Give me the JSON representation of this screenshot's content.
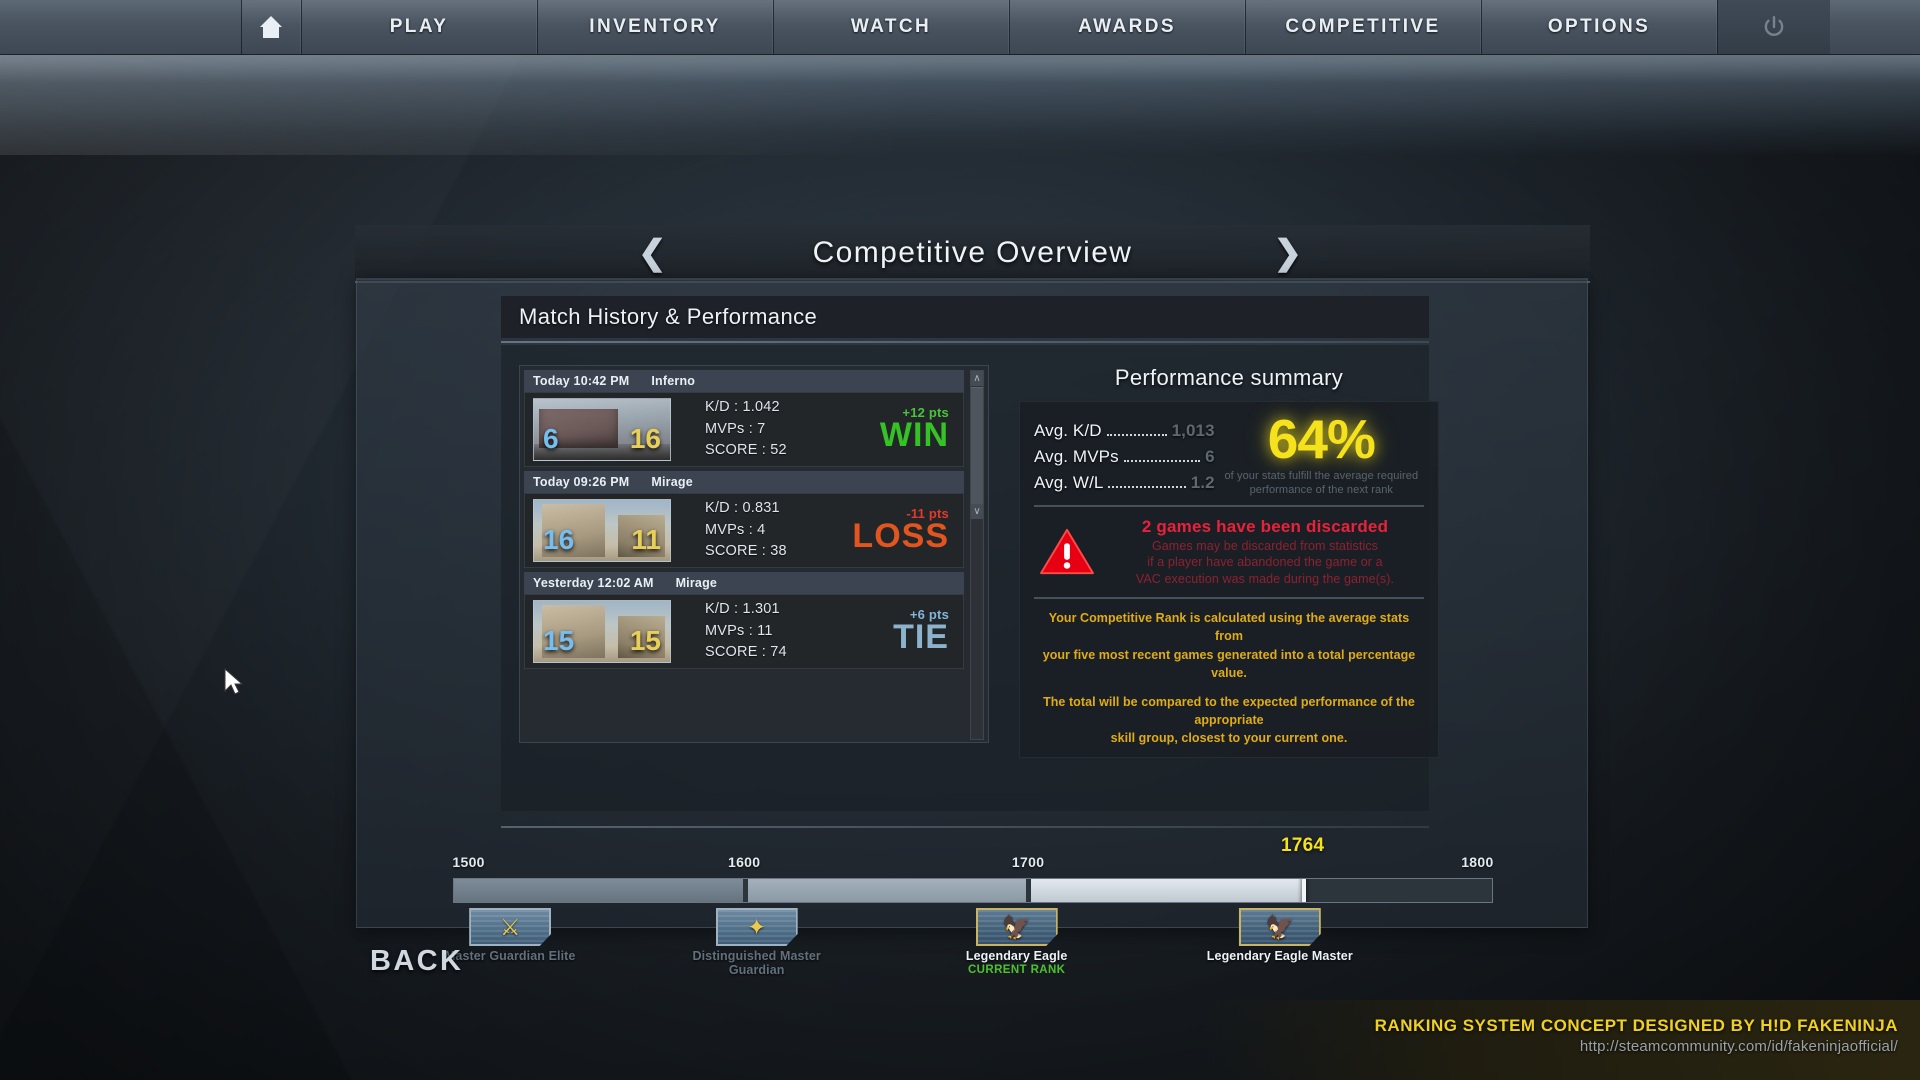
{
  "topnav": {
    "home_icon": "home-icon",
    "power_icon": "power-icon",
    "items": [
      {
        "label": "PLAY"
      },
      {
        "label": "INVENTORY"
      },
      {
        "label": "WATCH"
      },
      {
        "label": "AWARDS"
      },
      {
        "label": "COMPETITIVE"
      },
      {
        "label": "OPTIONS"
      }
    ]
  },
  "header": {
    "title": "Competitive Overview",
    "prev_arrow": "❮",
    "next_arrow": "❯"
  },
  "section": {
    "title": "Match History & Performance"
  },
  "matches": [
    {
      "date": "Today 10:42 PM",
      "map": "Inferno",
      "score_ct": "6",
      "score_t": "16",
      "kd_label": "K/D : 1.042",
      "mvp_label": "MVPs :  7",
      "score_label": "SCORE : 52",
      "points": "+12 pts",
      "verdict": "WIN",
      "result_kind": "win"
    },
    {
      "date": "Today 09:26 PM",
      "map": "Mirage",
      "score_ct": "16",
      "score_t": "11",
      "kd_label": "K/D : 0.831",
      "mvp_label": "MVPs :  4",
      "score_label": "SCORE : 38",
      "points": "-11 pts",
      "verdict": "LOSS",
      "result_kind": "loss"
    },
    {
      "date": "Yesterday 12:02 AM",
      "map": "Mirage",
      "score_ct": "15",
      "score_t": "15",
      "kd_label": "K/D : 1.301",
      "mvp_label": "MVPs :  11",
      "score_label": "SCORE : 74",
      "points": "+6 pts",
      "verdict": "TIE",
      "result_kind": "tie"
    }
  ],
  "scrollbar": {
    "up_arrow": "∧",
    "down_arrow": "∨"
  },
  "performance": {
    "title": "Performance summary",
    "averages": [
      {
        "label": "Avg. K/D",
        "value": "1,013"
      },
      {
        "label": "Avg. MVPs",
        "value": "6"
      },
      {
        "label": "Avg. W/L",
        "value": "1.2"
      }
    ],
    "percent": "64%",
    "percent_desc_line1": "of your stats fulfill the average required",
    "percent_desc_line2": "performance of the next rank",
    "warning": {
      "icon": "warning-triangle-icon",
      "title": "2 games have been discarded",
      "lines": [
        "Games may be discarded from statistics",
        "if a player have abandoned the game or a",
        "VAC execution was made during the game(s)."
      ]
    },
    "notes": [
      "Your Competitive Rank is calculated using the average stats from",
      "your five most recent games generated into a total percentage value.",
      "The total will be compared to the expected performance of the  appropriate",
      "skill group, closest to your current one."
    ]
  },
  "rank_progress": {
    "ticks": [
      {
        "label": "1500",
        "pos": 1.5,
        "current": false
      },
      {
        "label": "1600",
        "pos": 28.0,
        "current": false
      },
      {
        "label": "1700",
        "pos": 55.3,
        "current": false
      },
      {
        "label": "1764",
        "pos": 81.7,
        "current": true
      },
      {
        "label": "1800",
        "pos": 81.7,
        "current": false
      }
    ],
    "current_value": "1764",
    "ranks": [
      {
        "name": "Master Guardian Elite",
        "pos": 5.5,
        "glyph": "⚔",
        "state": "inactive",
        "sub": ""
      },
      {
        "name": "Distinguished Master Guardian",
        "pos": 29.2,
        "glyph": "✦",
        "state": "inactive",
        "sub": ""
      },
      {
        "name": "Legendary Eagle",
        "pos": 54.2,
        "glyph": "🦅",
        "state": "active",
        "sub": "CURRENT RANK"
      },
      {
        "name": "Legendary Eagle Master",
        "pos": 79.5,
        "glyph": "🦅",
        "state": "active",
        "sub": ""
      }
    ]
  },
  "back": {
    "label": "BACK"
  },
  "credits": {
    "main": "RANKING SYSTEM CONCEPT DESIGNED BY H!D FAKENINJA",
    "url": "http://steamcommunity.com/id/fakeninjaofficial/"
  },
  "colors": {
    "win": "#35c224",
    "loss": "#e2551f",
    "tie": "#8cb3cb",
    "accent_yellow": "#f5e21c",
    "warning_red": "#e8223a",
    "current_rank_green": "#4cc22c"
  }
}
